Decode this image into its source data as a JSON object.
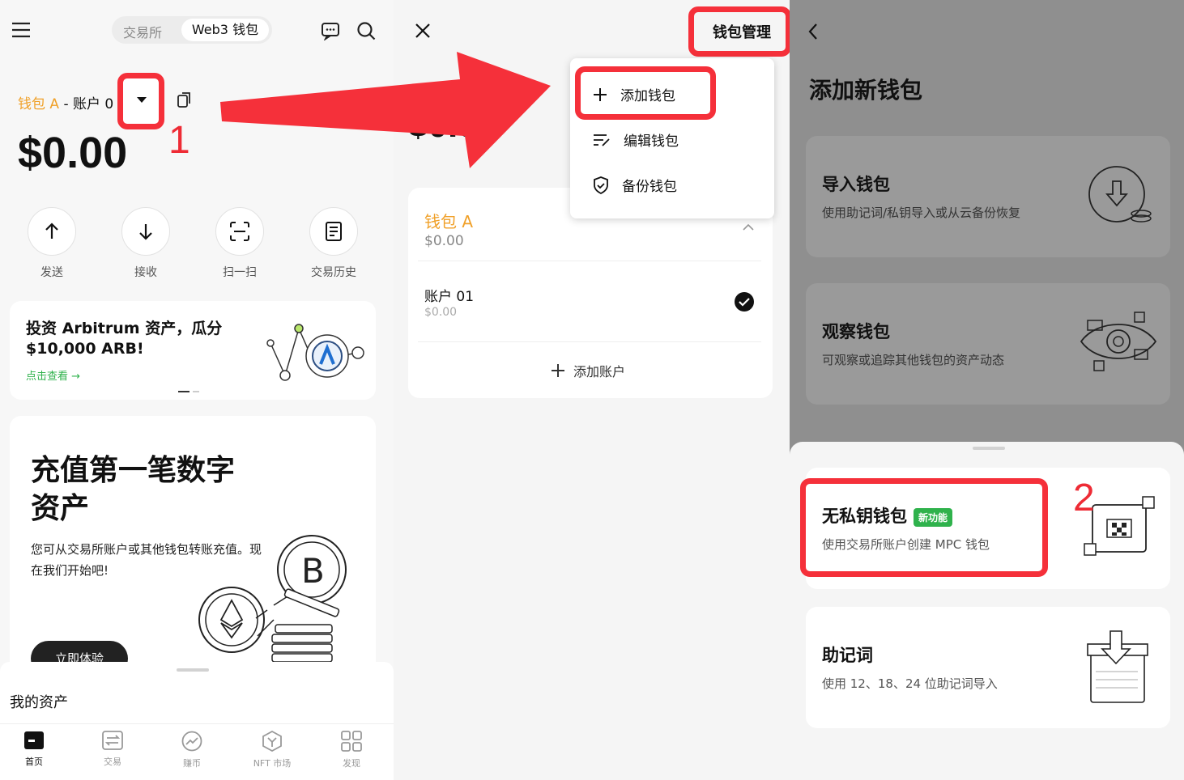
{
  "panel1": {
    "segment": {
      "exchange": "交易所",
      "web3": "Web3 钱包"
    },
    "wallet_name": "钱包 A",
    "account_label": " - 账户 0",
    "balance": "$0.00",
    "step_number": "1",
    "actions": [
      {
        "label": "发送",
        "icon": "arrow-up-icon"
      },
      {
        "label": "接收",
        "icon": "arrow-down-icon"
      },
      {
        "label": "扫一扫",
        "icon": "scan-icon"
      },
      {
        "label": "交易历史",
        "icon": "history-icon"
      }
    ],
    "promo": {
      "title": "投资 Arbitrum 资产，瓜分 $10,000 ARB!",
      "link": "点击查看 →"
    },
    "deposit": {
      "title": "充值第一笔数字资产",
      "desc": "您可从交易所账户或其他钱包转账充值。现在我们开始吧!",
      "button": "立即体验"
    },
    "my_assets": "我的资产",
    "tabs": [
      "首页",
      "交易",
      "赚币",
      "NFT 市场",
      "发现"
    ]
  },
  "panel2": {
    "wallet_manage": "钱包管理",
    "balance_partial": "$0.00",
    "menu": {
      "add": "添加钱包",
      "edit": "编辑钱包",
      "backup": "备份钱包"
    },
    "wallet": {
      "name": "钱包 A",
      "balance": "$0.00"
    },
    "account": {
      "name": "账户 01",
      "balance": "$0.00"
    },
    "add_account": "添加账户"
  },
  "panel3": {
    "title": "添加新钱包",
    "import": {
      "title": "导入钱包",
      "desc": "使用助记词/私钥导入或从云备份恢复"
    },
    "watch": {
      "title": "观察钱包",
      "desc": "可观察或追踪其他钱包的资产动态"
    },
    "keyless": {
      "title": "无私钥钱包",
      "badge": "新功能",
      "desc": "使用交易所账户创建 MPC 钱包"
    },
    "mnemonic": {
      "title": "助记词",
      "desc": "使用 12、18、24 位助记词导入"
    },
    "step_number": "2"
  },
  "colors": {
    "accent_red": "#f5303a",
    "brand_green": "#2fb24c",
    "wallet_orange": "#f0a028"
  }
}
